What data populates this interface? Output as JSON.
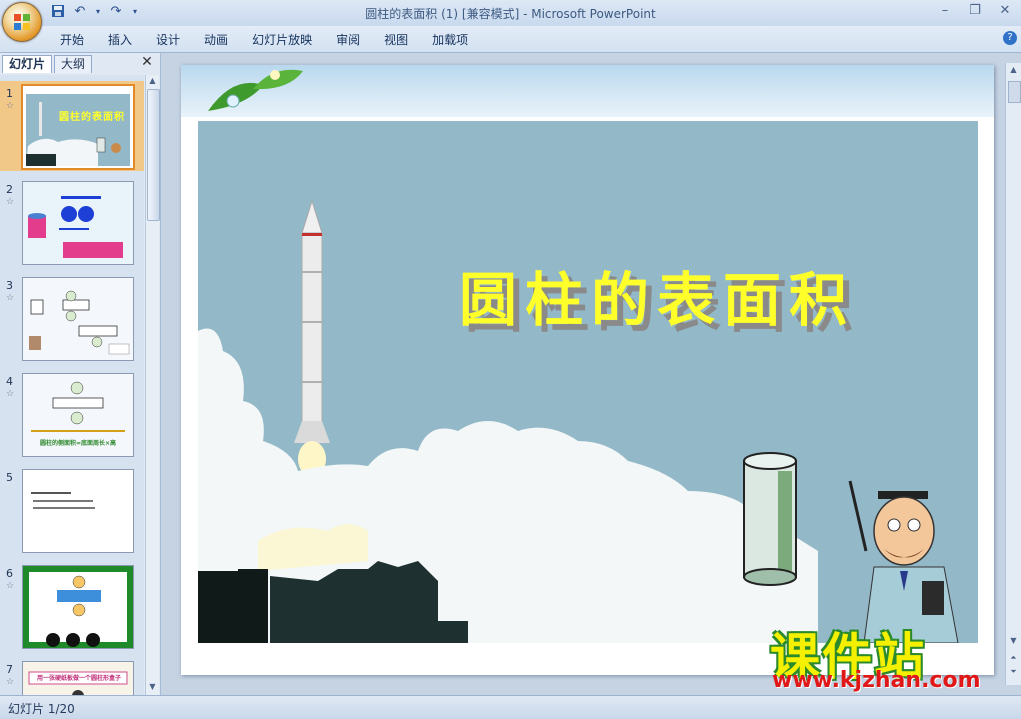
{
  "window": {
    "title": "圆柱的表面积 (1) [兼容模式] - Microsoft PowerPoint"
  },
  "qat": {
    "save_icon": "save-icon",
    "undo_icon": "undo-icon",
    "redo_icon": "redo-icon"
  },
  "ribbon": {
    "tabs": [
      "开始",
      "插入",
      "设计",
      "动画",
      "幻灯片放映",
      "审阅",
      "视图",
      "加载项"
    ]
  },
  "leftpane": {
    "tabs": [
      "幻灯片",
      "大纲"
    ],
    "thumbnails": [
      {
        "number": "1",
        "title": "圆柱的表面积"
      },
      {
        "number": "2"
      },
      {
        "number": "3"
      },
      {
        "number": "4",
        "caption": "圆柱的侧面积=底面周长×高"
      },
      {
        "number": "5"
      },
      {
        "number": "6"
      },
      {
        "number": "7",
        "title": "用一张硬纸板做一个圆柱形盒子"
      }
    ]
  },
  "slide": {
    "title": "圆柱的表面积"
  },
  "watermark": {
    "brand": "课件站",
    "url": "www.kjzhan.com"
  },
  "status": {
    "slide_counter": "幻灯片 1/20"
  }
}
